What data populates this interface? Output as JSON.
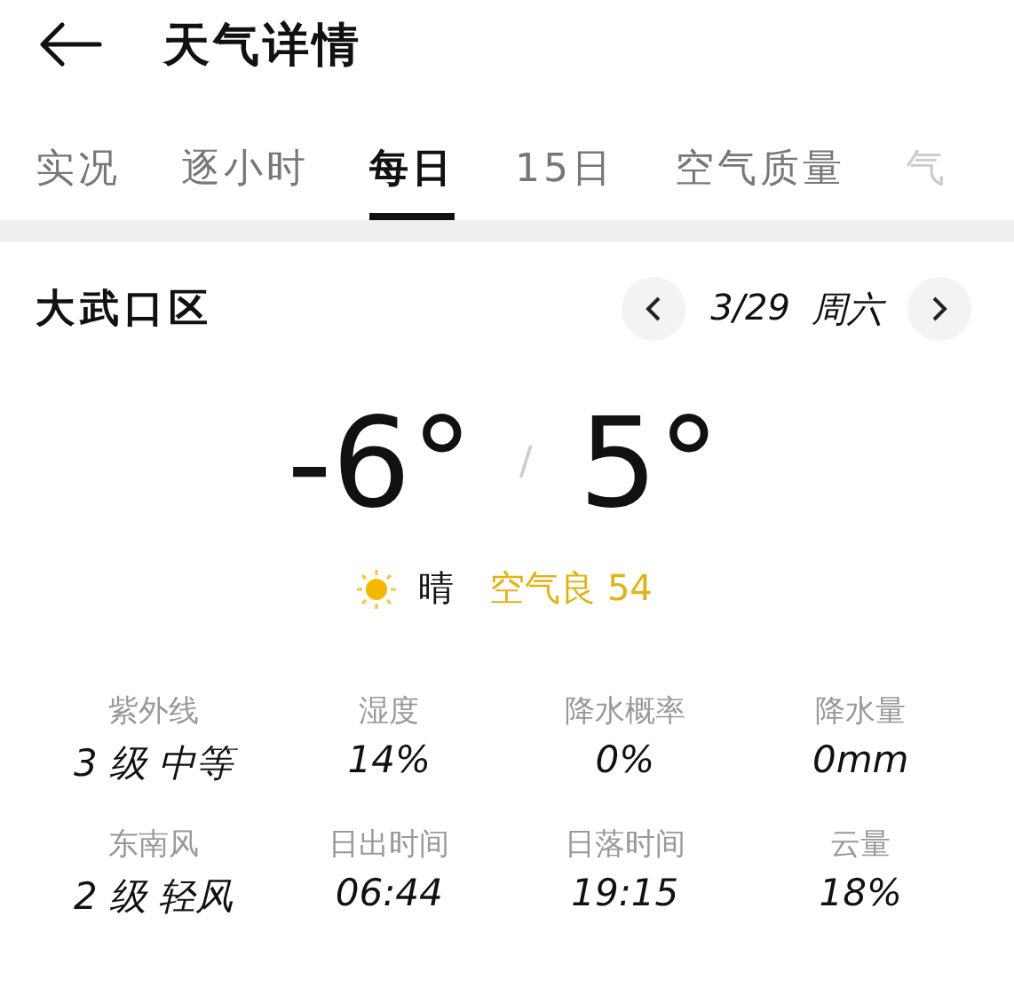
{
  "header": {
    "title": "天气详情"
  },
  "tabs": [
    {
      "label": "实况",
      "selected": false
    },
    {
      "label": "逐小时",
      "selected": false
    },
    {
      "label": "每日",
      "selected": true
    },
    {
      "label": "15日",
      "selected": false
    },
    {
      "label": "空气质量",
      "selected": false
    },
    {
      "label": "气",
      "selected": false
    }
  ],
  "location": "大武口区",
  "date": {
    "text": "3/29",
    "weekday": "周六"
  },
  "temperature": {
    "low": "-6°",
    "separator": "/",
    "high": "5°"
  },
  "condition": {
    "text": "晴",
    "air_quality": "空气良 54"
  },
  "stats": [
    {
      "label": "紫外线",
      "value": "3 级 中等"
    },
    {
      "label": "湿度",
      "value": "14%"
    },
    {
      "label": "降水概率",
      "value": "0%"
    },
    {
      "label": "降水量",
      "value": "0mm"
    },
    {
      "label": "东南风",
      "value": "2 级 轻风"
    },
    {
      "label": "日出时间",
      "value": "06:44"
    },
    {
      "label": "日落时间",
      "value": "19:15"
    },
    {
      "label": "云量",
      "value": "18%"
    }
  ]
}
